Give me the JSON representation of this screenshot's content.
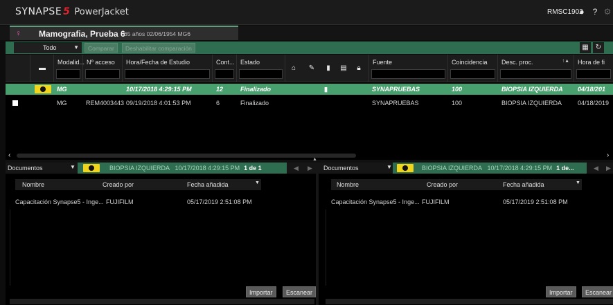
{
  "app": {
    "brand": "SYNAPSE",
    "brand_number": "5",
    "product": "PowerJacket",
    "user": "RMSC1902"
  },
  "patient_tab": {
    "name": "Mamografia, Prueba 6",
    "meta": "65 años  02/06/1954  MG6"
  },
  "toolbar": {
    "filter_value": "Todo",
    "compare_label": "Comparar",
    "disable_compare_label": "Deshabilitar comparación"
  },
  "grid": {
    "columns": {
      "modality": "Modalid...",
      "accession": "Nº acceso",
      "datetime": "Hora/Fecha de Estudio",
      "count": "Cont...",
      "status": "Estado",
      "source": "Fuente",
      "match": "Coincidencia",
      "desc": "Desc. proc.",
      "end_time": "Hora de fi"
    },
    "rows": [
      {
        "modality": "MG",
        "accession": "",
        "datetime": "10/17/2018 4:29:15 PM",
        "count": "12",
        "status": "Finalizado",
        "source": "SYNAPRUEBAS",
        "match": "100",
        "desc": "BIOPSIA IZQUIERDA",
        "end_time": "04/18/201"
      },
      {
        "modality": "MG",
        "accession": "REM4003443",
        "datetime": "09/19/2018 4:01:53 PM",
        "count": "6",
        "status": "Finalizado",
        "source": "SYNAPRUEBAS",
        "match": "100",
        "desc": "BIOPSIA IZQUIERDA",
        "end_time": "04/18/2019"
      }
    ]
  },
  "left_panel": {
    "title": "Documentos",
    "study": "BIOPSIA IZQUIERDA",
    "study_date": "10/17/2018 4:29:15 PM",
    "page": "1 de 1",
    "col_name": "Nombre",
    "col_created_by": "Creado por",
    "col_date_added": "Fecha añadida",
    "doc": {
      "name": "Capacitación Synapse5 - Inge...",
      "created_by": "FUJIFILM",
      "date_added": "05/17/2019 2:51:08 PM"
    },
    "import_label": "Importar",
    "scan_label": "Escanear"
  },
  "right_panel": {
    "title": "Documentos",
    "study": "BIOPSIA IZQUIERDA",
    "study_date": "10/17/2018 4:29:15 PM",
    "page": "1 de...",
    "col_name": "Nombre",
    "col_created_by": "Creado por",
    "col_date_added": "Fecha añadida",
    "doc": {
      "name": "Capacitación Synapse5 - Inge...",
      "created_by": "FUJIFILM",
      "date_added": "05/17/2019 2:51:08 PM"
    },
    "import_label": "Importar",
    "scan_label": "Escanear"
  },
  "colors": {
    "accent_green": "#2f6d50",
    "selected_row": "#48a06e",
    "brand_red": "#e0222e",
    "marker_yellow": "#f0d51c"
  }
}
